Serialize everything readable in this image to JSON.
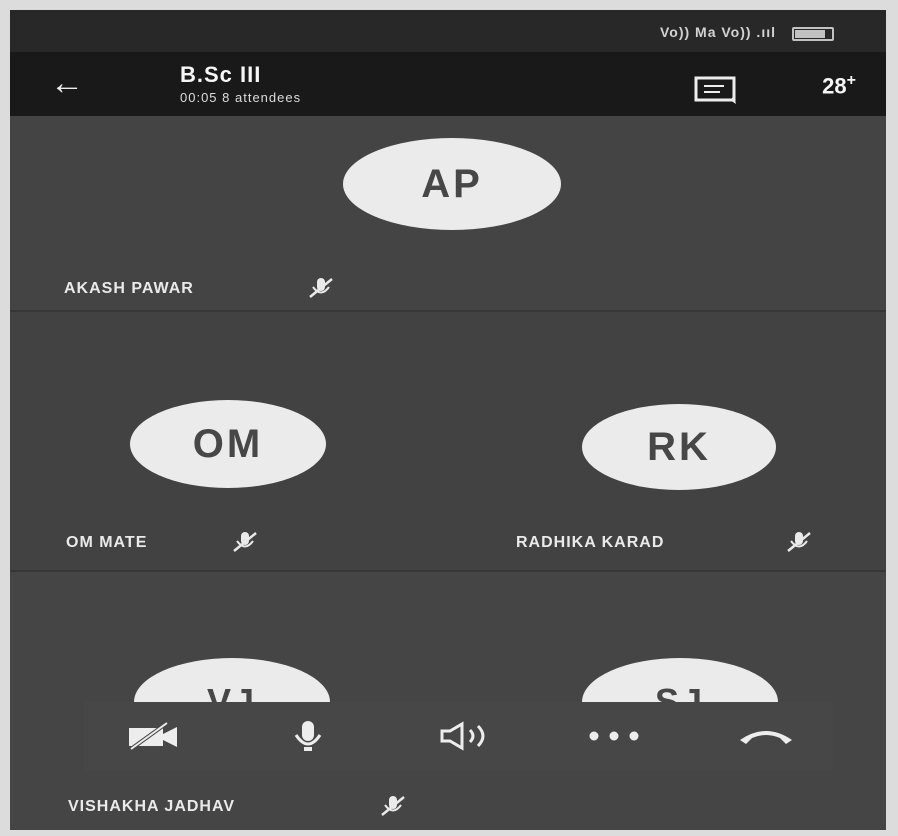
{
  "status_bar": {
    "text": "Vo)) Ma Vo)) .ııl"
  },
  "header": {
    "title": "B.Sc III",
    "subtitle": "00:05  8 attendees",
    "participants_count": "28"
  },
  "participants": [
    {
      "initials": "AP",
      "name": "AKASH PAWAR"
    },
    {
      "initials": "OM",
      "name": "OM MATE"
    },
    {
      "initials": "RK",
      "name": "RADHIKA KARAD"
    },
    {
      "initials": "VJ",
      "name": "VISHAKHA JADHAV"
    },
    {
      "initials": "SJ",
      "name": ""
    }
  ],
  "controls": [
    "video-off",
    "microphone",
    "speaker",
    "more",
    "end-call"
  ],
  "colors": {
    "tile": "#474747",
    "header": "#1e1e1e",
    "avatar": "#e6e6e6",
    "text": "#e5e5e5"
  }
}
